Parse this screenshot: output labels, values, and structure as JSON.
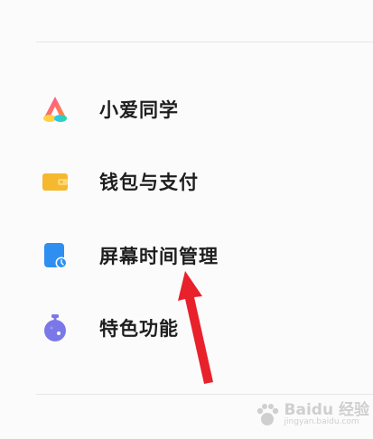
{
  "settings": {
    "items": [
      {
        "label": "小爱同学",
        "icon": "xiaoai-assistant-icon"
      },
      {
        "label": "钱包与支付",
        "icon": "wallet-icon"
      },
      {
        "label": "屏幕时间管理",
        "icon": "screen-time-icon"
      },
      {
        "label": "特色功能",
        "icon": "special-features-icon"
      }
    ]
  },
  "watermark": {
    "brand": "Baidu 经验",
    "site": "jingyan.baidu.com"
  },
  "colors": {
    "wallet": "#f5b82e",
    "screen_time": "#2e8ff0",
    "features": "#7a78e8",
    "annotation_arrow": "#e8212b",
    "label_text": "#1e1e1e"
  }
}
